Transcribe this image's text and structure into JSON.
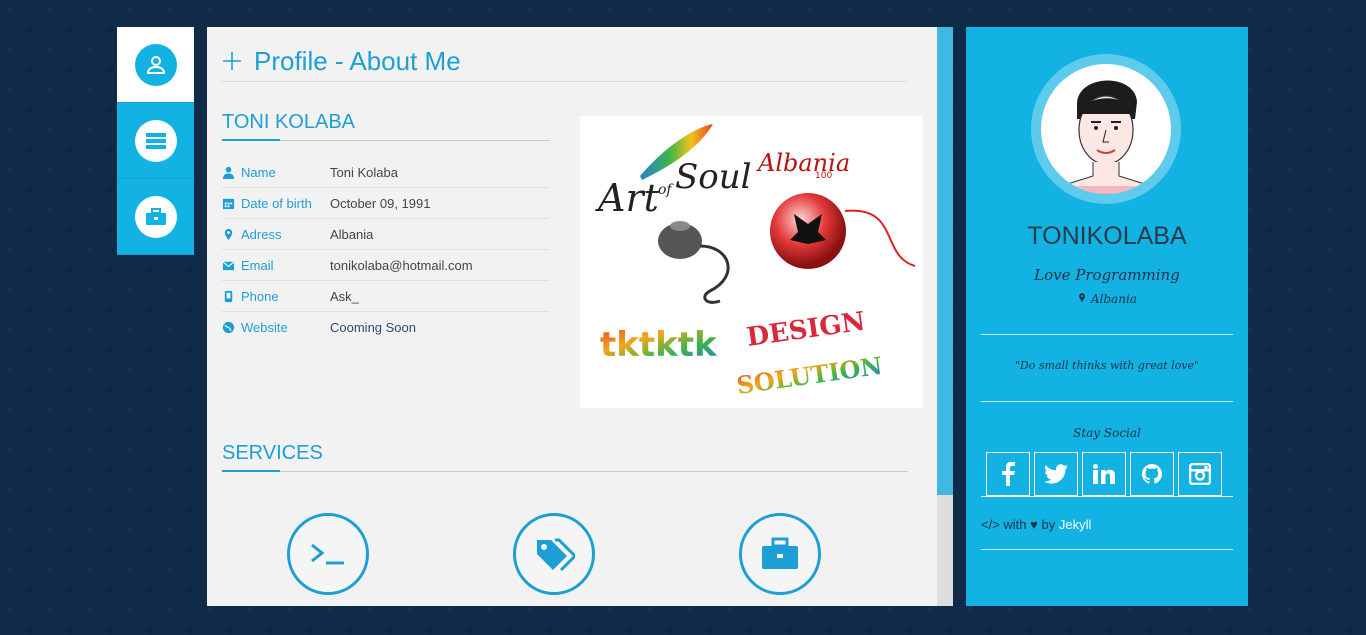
{
  "nav": {
    "tabs": [
      {
        "icon": "user-icon",
        "active": true
      },
      {
        "icon": "resume-icon",
        "active": false
      },
      {
        "icon": "briefcase-icon",
        "active": false
      }
    ]
  },
  "header": {
    "title": "Profile - About Me"
  },
  "about": {
    "name_heading": "TONI KOLABA",
    "rows": [
      {
        "label": "Name",
        "value": "Toni Kolaba",
        "icon": "user-icon"
      },
      {
        "label": "Date of birth",
        "value": "October 09, 1991",
        "icon": "calendar-icon"
      },
      {
        "label": "Adress",
        "value": "Albania",
        "icon": "map-marker-icon"
      },
      {
        "label": "Email",
        "value": "tonikolaba@hotmail.com",
        "icon": "envelope-icon"
      },
      {
        "label": "Phone",
        "value": "Ask_",
        "icon": "phone-icon"
      },
      {
        "label": "Website",
        "value": "Cooming Soon",
        "icon": "globe-icon"
      }
    ]
  },
  "artwork": {
    "text_art": "Art",
    "text_of": "of",
    "text_soul": "Soul",
    "text_albania": "Albania",
    "text_100": "100",
    "text_design": "DESIGN",
    "text_solution": "SOLUTION",
    "text_tk": "tktktk"
  },
  "services": {
    "heading": "SERVICES",
    "items": [
      {
        "icon": "terminal-icon"
      },
      {
        "icon": "tags-icon"
      },
      {
        "icon": "briefcase-icon"
      }
    ]
  },
  "profile": {
    "name": "TONIKOLABA",
    "tagline": "Love Programming",
    "location": "Albania",
    "quote": "\"Do small thinks with great love\"",
    "stay_social": "Stay Social",
    "socials": [
      {
        "label": "f",
        "icon": "facebook-icon"
      },
      {
        "label": "t",
        "icon": "twitter-icon"
      },
      {
        "label": "in",
        "icon": "linkedin-icon"
      },
      {
        "label": "gh",
        "icon": "github-icon"
      },
      {
        "label": "ig",
        "icon": "instagram-icon"
      }
    ],
    "credits_prefix": "</> with",
    "credits_heart": "♥",
    "credits_by": "by",
    "credits_link": "Jekyll"
  },
  "colors": {
    "accent": "#1d9fd6",
    "panel": "#12b2e2",
    "background": "#0f2b48"
  }
}
